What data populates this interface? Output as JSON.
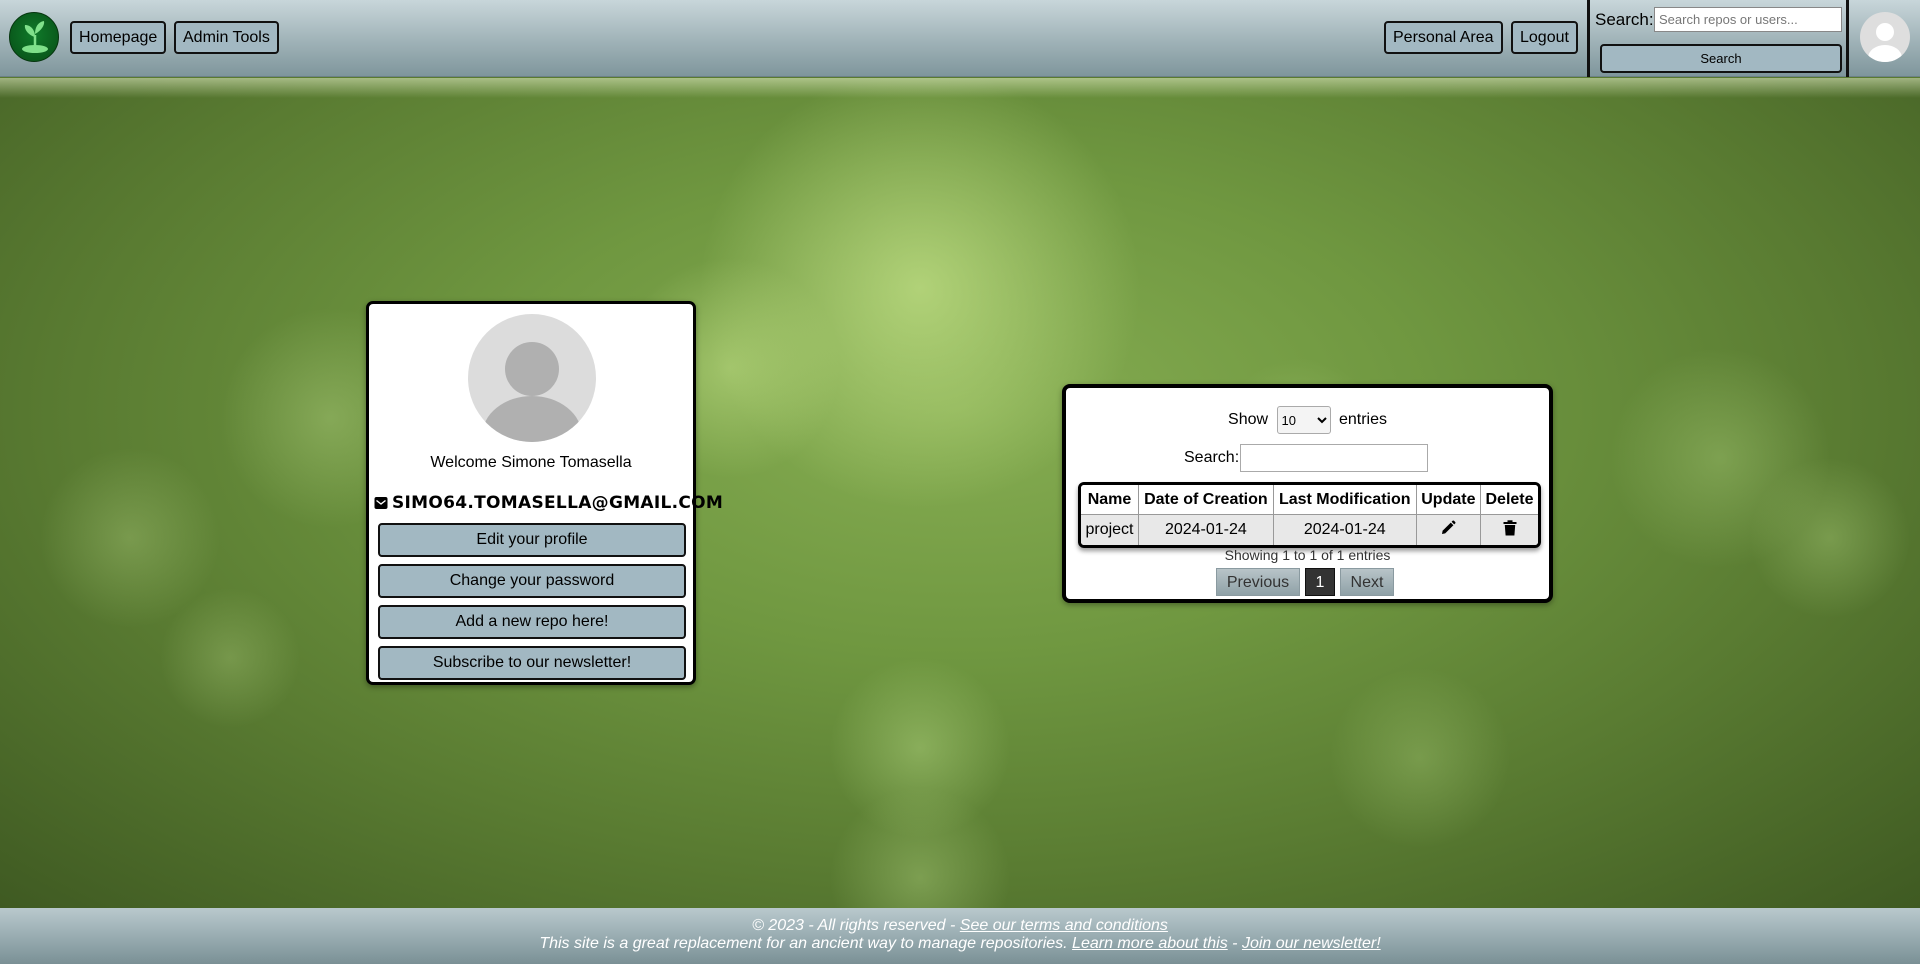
{
  "header": {
    "logo_icon": "sprout-logo-icon",
    "nav": {
      "homepage": "Homepage",
      "admin_tools": "Admin Tools",
      "personal_area": "Personal Area",
      "logout": "Logout"
    },
    "search": {
      "label": "Search:",
      "placeholder": "Search repos or users...",
      "button": "Search"
    },
    "avatar_icon": "user-avatar-icon"
  },
  "profile": {
    "welcome": "Welcome Simone Tomasella",
    "email": "simo64.tomasella@gmail.com",
    "email_icon": "envelope-icon",
    "buttons": {
      "edit": "Edit your profile",
      "password": "Change your password",
      "new_repo": "Add a new repo here!",
      "newsletter": "Subscribe to our newsletter!"
    }
  },
  "repos": {
    "length": {
      "before": "Show",
      "selected": "10",
      "after": "entries"
    },
    "filter_label": "Search:",
    "columns": [
      "Name",
      "Date of Creation",
      "Last Modification",
      "Update",
      "Delete"
    ],
    "rows": [
      {
        "name": "project",
        "created": "2024-01-24",
        "modified": "2024-01-24",
        "update_icon": "pencil-icon",
        "delete_icon": "trash-icon"
      }
    ],
    "info": "Showing 1 to 1 of 1 entries",
    "paging": {
      "previous": "Previous",
      "current": "1",
      "next": "Next"
    }
  },
  "footer": {
    "copyright": "© 2023 - All rights reserved -",
    "terms": "See our terms and conditions",
    "tagline": "This site is a great replacement for an ancient way to manage repositories.",
    "learn_more": "Learn more about this",
    "separator": "-",
    "join": "Join our newsletter!"
  }
}
